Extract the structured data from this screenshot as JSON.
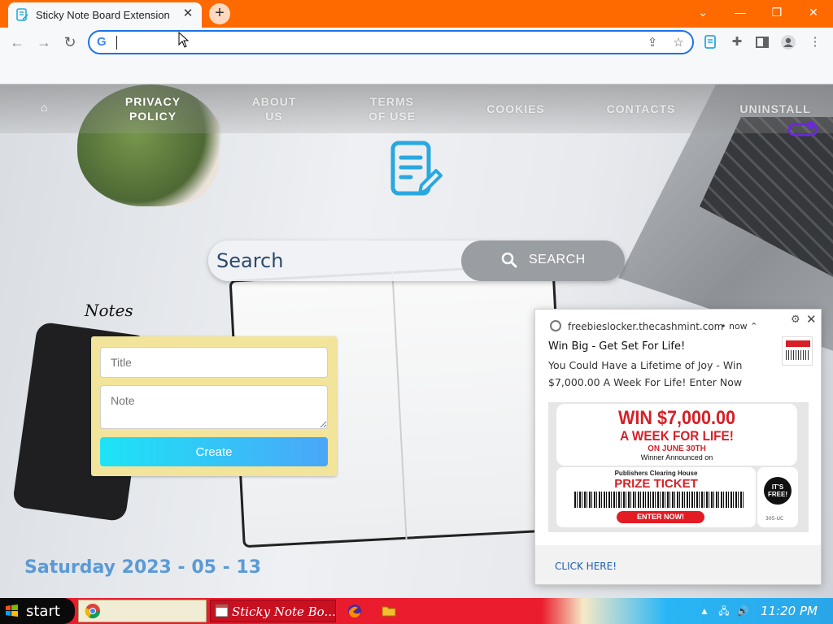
{
  "browser": {
    "tab_title": "Sticky Note Board Extension",
    "tab_close": "✕",
    "new_tab": "+",
    "window_controls": {
      "chevron": "⌄",
      "minimize": "—",
      "restore": "❐",
      "close": "✕"
    },
    "omnibox_value": "",
    "icons": [
      "back-icon",
      "forward-icon",
      "reload-icon",
      "google-icon",
      "share-icon",
      "star-icon",
      "extension-page-icon",
      "puzzle-icon",
      "sidepanel-icon",
      "profile-icon",
      "menu-icon"
    ]
  },
  "nav": {
    "links": [
      "PRIVACY\nPOLICY",
      "ABOUT\nUS",
      "TERMS\nOF USE",
      "COOKIES",
      "CONTACTS",
      "UNINSTALL"
    ]
  },
  "search": {
    "placeholder": "Search",
    "button_label": "SEARCH"
  },
  "notes": {
    "heading": "Notes",
    "title_placeholder": "Title",
    "note_placeholder": "Note",
    "create_label": "Create"
  },
  "date": "Saturday 2023 - 05 - 13",
  "notification": {
    "site": "freebieslocker.thecashmint.com",
    "time": "• now ⌃",
    "title": "Win Big - Get Set For Life!",
    "body": "You Could Have a Lifetime of Joy - Win $7,000.00 A Week For Life! Enter Now",
    "image": {
      "line1": "WIN $7,000.00",
      "line2": "A WEEK FOR LIFE!",
      "line3": "ON JUNE 30TH",
      "line4": "Winner Announced on",
      "pch": "Publishers Clearing House",
      "prize": "PRIZE TICKET",
      "enter": "ENTER NOW!",
      "free": "IT'S FREE!",
      "code": "305-UC"
    },
    "action": "CLICK HERE!"
  },
  "taskbar": {
    "start": "start",
    "active_task": "Sticky Note Bo...",
    "time": "11:20 PM"
  },
  "colors": {
    "tabbar": "#ff6a00",
    "accent_blue": "#1a73e8",
    "date_blue": "#5b9ad6",
    "notes_card": "#f2e49a",
    "create_gradient_start": "#1de4f6",
    "create_gradient_end": "#4aa6f8",
    "logo": "#29a8e0",
    "taskbar_red": "#e81d2f"
  }
}
